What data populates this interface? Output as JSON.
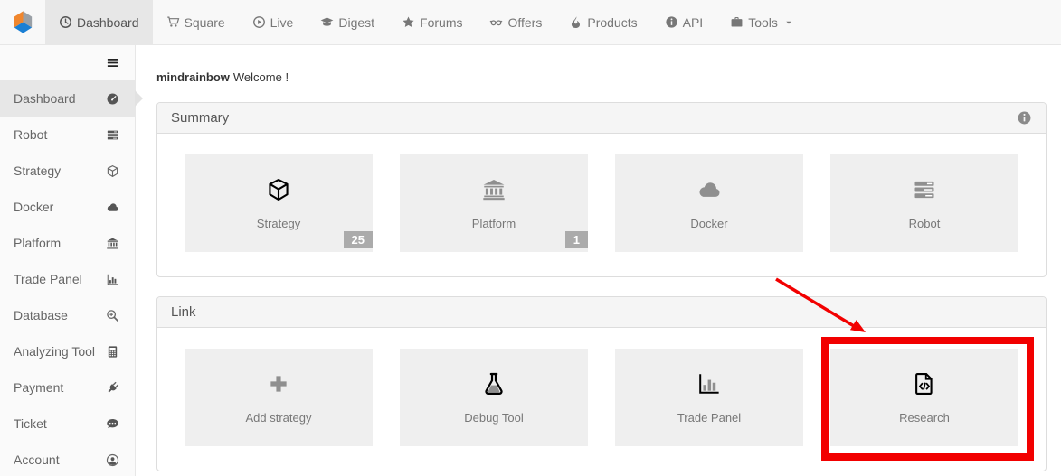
{
  "navbar": {
    "brand": {
      "icon": "fmz-cube-logo"
    },
    "items": [
      {
        "label": "Dashboard",
        "icon": "clock-icon",
        "active": true
      },
      {
        "label": "Square",
        "icon": "shopping-cart-icon"
      },
      {
        "label": "Live",
        "icon": "play-circle-icon"
      },
      {
        "label": "Digest",
        "icon": "graduation-cap-icon"
      },
      {
        "label": "Forums",
        "icon": "star-icon"
      },
      {
        "label": "Offers",
        "icon": "glasses-icon"
      },
      {
        "label": "Products",
        "icon": "fire-icon"
      },
      {
        "label": "API",
        "icon": "info-circle-icon"
      },
      {
        "label": "Tools",
        "icon": "briefcase-icon",
        "dropdown": true
      }
    ]
  },
  "sidebar": {
    "toggle_icon": "hamburger-icon",
    "items": [
      {
        "label": "Dashboard",
        "icon": "gauge-icon",
        "active": true
      },
      {
        "label": "Robot",
        "icon": "tasks-icon"
      },
      {
        "label": "Strategy",
        "icon": "cube-icon"
      },
      {
        "label": "Docker",
        "icon": "cloud-icon"
      },
      {
        "label": "Platform",
        "icon": "bank-icon"
      },
      {
        "label": "Trade Panel",
        "icon": "bar-chart-icon"
      },
      {
        "label": "Database",
        "icon": "search-plus-icon"
      },
      {
        "label": "Analyzing Tool",
        "icon": "calculator-icon"
      },
      {
        "label": "Payment",
        "icon": "plug-icon"
      },
      {
        "label": "Ticket",
        "icon": "comment-icon"
      },
      {
        "label": "Account",
        "icon": "user-circle-icon"
      }
    ]
  },
  "main": {
    "welcome": {
      "username": "mindrainbow",
      "greeting": "Welcome !"
    },
    "panels": [
      {
        "title": "Summary",
        "info_icon": "info-circle-icon",
        "tiles": [
          {
            "label": "Strategy",
            "icon": "cube-icon",
            "badge": "25"
          },
          {
            "label": "Platform",
            "icon": "bank-icon",
            "badge": "1"
          },
          {
            "label": "Docker",
            "icon": "cloud-icon"
          },
          {
            "label": "Robot",
            "icon": "tasks-icon"
          }
        ]
      },
      {
        "title": "Link",
        "tiles": [
          {
            "label": "Add strategy",
            "icon": "plus-icon"
          },
          {
            "label": "Debug Tool",
            "icon": "flask-icon"
          },
          {
            "label": "Trade Panel",
            "icon": "bar-chart-icon"
          },
          {
            "label": "Research",
            "icon": "file-code-icon",
            "highlighted": true
          }
        ]
      }
    ],
    "annotation": {
      "shape": "red-box-and-arrow",
      "target": "Research",
      "color": "#f20000"
    }
  }
}
